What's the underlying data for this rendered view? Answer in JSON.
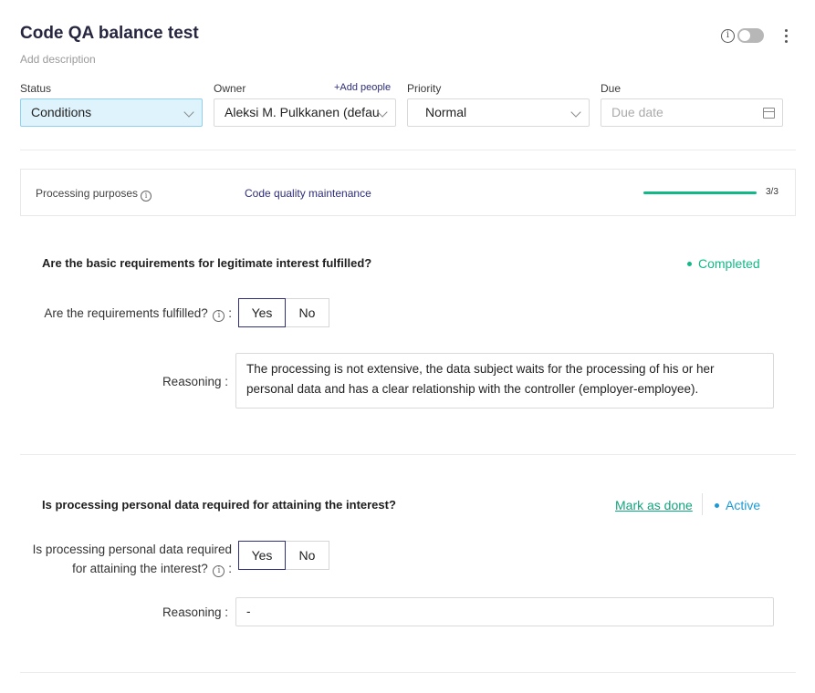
{
  "header": {
    "title": "Code QA balance test",
    "description_placeholder": "Add description",
    "info_icon": "info-icon",
    "more_icon": "kebab-icon"
  },
  "fields": {
    "status_label": "Status",
    "status_value": "Conditions",
    "owner_label": "Owner",
    "add_people": "+Add people",
    "owner_value": "Aleksi M. Pulkkanen (default)",
    "priority_label": "Priority",
    "priority_value": "Normal",
    "due_label": "Due",
    "due_placeholder": "Due date"
  },
  "purposes": {
    "label": "Processing purposes",
    "link": "Code quality maintenance",
    "progress_fraction": 1.0,
    "count": "3/3"
  },
  "sections": [
    {
      "question": "Are the basic requirements for legitimate interest fulfilled?",
      "state": "Completed",
      "field_label": "Are the requirements fulfilled?",
      "yes": "Yes",
      "no": "No",
      "reasoning_label": "Reasoning :",
      "reasoning": "The processing is not extensive, the data subject waits for the processing of his or her personal data and has a clear relationship with the controller (employer-employee)."
    },
    {
      "question": "Is processing personal data required for attaining the interest?",
      "mark_done": "Mark as done",
      "state": "Active",
      "field_label_line1": "Is processing personal data required",
      "field_label_line2": "for attaining the interest?",
      "yes": "Yes",
      "no": "No",
      "reasoning_label": "Reasoning :",
      "reasoning": "-"
    }
  ],
  "colors": {
    "accent": "#2e2e7a",
    "completed": "#12b886",
    "active": "#1c9ad6",
    "status_bg": "#dff3fc"
  }
}
